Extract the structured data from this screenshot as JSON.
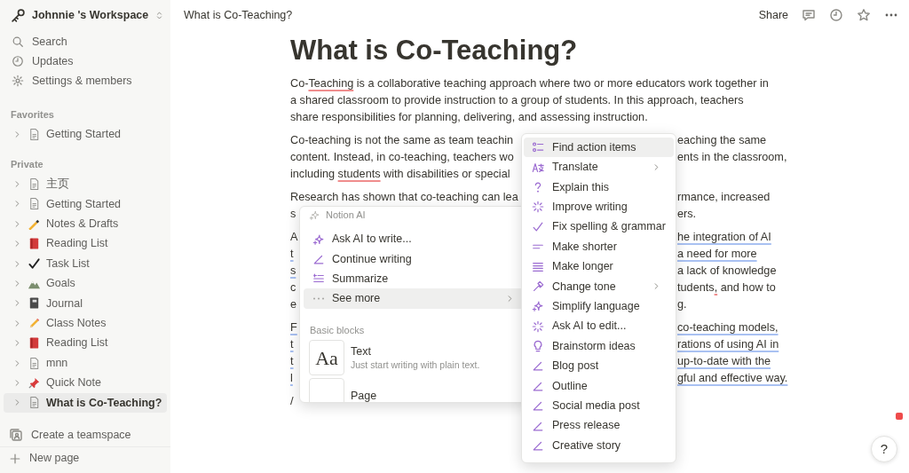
{
  "sidebar": {
    "workspace": "Johnnie 's Workspace",
    "nav": [
      "Search",
      "Updates",
      "Settings & members"
    ],
    "favorites": {
      "label": "Favorites",
      "items": [
        {
          "label": "Getting Started"
        }
      ]
    },
    "private": {
      "label": "Private",
      "items": [
        {
          "label": "主页",
          "selected": false
        },
        {
          "label": "Getting Started",
          "selected": false
        },
        {
          "label": "Notes & Drafts",
          "selected": false
        },
        {
          "label": "Reading List",
          "selected": false
        },
        {
          "label": "Task List",
          "selected": false
        },
        {
          "label": "Goals",
          "selected": false
        },
        {
          "label": "Journal",
          "selected": false
        },
        {
          "label": "Class Notes",
          "selected": false
        },
        {
          "label": "Reading List",
          "selected": false
        },
        {
          "label": "mnn",
          "selected": false
        },
        {
          "label": "Quick Note",
          "selected": false
        },
        {
          "label": "What is Co-Teaching?",
          "selected": true
        }
      ]
    },
    "create_teamspace": "Create a teamspace",
    "new_page": "New page"
  },
  "topbar": {
    "breadcrumb": "What is Co-Teaching?",
    "share": "Share"
  },
  "page": {
    "title": "What is Co-Teaching?",
    "paragraphs": [
      {
        "lines": [
          {
            "left": [
              {
                "text": "Co-"
              },
              {
                "text": "Teaching",
                "spellcheck": true
              },
              {
                "text": " is a collaborative teaching approach where two or more educators work together in"
              }
            ]
          },
          {
            "left": [
              {
                "text": "a shared classroom to provide instruction to a group of students. In this approach, teachers"
              }
            ]
          },
          {
            "left": [
              {
                "text": "share responsibilities for planning, delivering, and assessing instruction."
              }
            ]
          }
        ]
      },
      {
        "lines": [
          {
            "left": [
              {
                "text": "Co-teaching is not the same as team teachin"
              }
            ],
            "right": [
              {
                "text": "eaching the same"
              }
            ]
          },
          {
            "left": [
              {
                "text": "content. Instead, in co-teaching, teachers wo"
              }
            ],
            "right": [
              {
                "text": "ents in the classroom,"
              }
            ]
          },
          {
            "left": [
              {
                "text": "including "
              },
              {
                "text": "students",
                "spellcheck": true
              },
              {
                "text": " with disabilities or special"
              }
            ]
          }
        ]
      },
      {
        "lines": [
          {
            "left": [
              {
                "text": "Research has shown that co-teaching can lea"
              }
            ],
            "right": [
              {
                "text": "rmance, increased"
              }
            ]
          },
          {
            "left": [
              {
                "text": "s"
              }
            ],
            "right": [
              {
                "text": "ers."
              }
            ]
          }
        ]
      },
      {
        "lines": [
          {
            "left": [
              {
                "text": "A"
              }
            ],
            "right": [
              {
                "text": "he integration of AI",
                "suggested": true
              }
            ]
          },
          {
            "left": [
              {
                "text": "t",
                "suggested": true
              }
            ],
            "right": [
              {
                "text": "a need for more",
                "suggested": true
              }
            ]
          },
          {
            "left": [
              {
                "text": "s",
                "suggested": true
              }
            ],
            "right": [
              {
                "text": "a lack of knowledge"
              }
            ]
          },
          {
            "left": [
              {
                "text": "c"
              }
            ],
            "right": [
              {
                "text": "tudents"
              },
              {
                "text": ",",
                "spellcheck": true
              },
              {
                "text": " and how to"
              }
            ]
          },
          {
            "left": [
              {
                "text": "e"
              }
            ],
            "right": [
              {
                "text": "g."
              }
            ]
          }
        ]
      },
      {
        "lines": [
          {
            "left": [
              {
                "text": "F",
                "suggested": true
              }
            ],
            "right": [
              {
                "text": "co-teaching models,",
                "suggested": true
              }
            ]
          },
          {
            "left": [
              {
                "text": "t",
                "suggested": true
              }
            ],
            "right": [
              {
                "text": "rations of using AI in",
                "suggested": true
              }
            ]
          },
          {
            "left": [
              {
                "text": "t",
                "suggested": true
              }
            ],
            "right": [
              {
                "text": "up-to-date with the",
                "suggested": true
              }
            ]
          },
          {
            "left": [
              {
                "text": "l",
                "suggested": true
              }
            ],
            "right": [
              {
                "text": "gful and effective way.",
                "suggested": true
              }
            ]
          }
        ]
      }
    ],
    "command": "/"
  },
  "slash_menu": {
    "header": "Notion AI",
    "items": [
      {
        "label": "Ask AI to write...",
        "selected": false,
        "submenu": false
      },
      {
        "label": "Continue writing",
        "selected": false,
        "submenu": false
      },
      {
        "label": "Summarize",
        "selected": false,
        "submenu": false
      },
      {
        "label": "See more",
        "selected": true,
        "submenu": true
      }
    ],
    "section": "Basic blocks",
    "blocks": [
      {
        "title": "Text",
        "description": "Just start writing with plain text.",
        "thumb": "Aa"
      },
      {
        "title": "Page"
      }
    ]
  },
  "ai_menu": {
    "items": [
      {
        "label": "Find action items",
        "selected": true,
        "submenu": false
      },
      {
        "label": "Translate",
        "selected": false,
        "submenu": true
      },
      {
        "label": "Explain this",
        "selected": false,
        "submenu": false
      },
      {
        "label": "Improve writing",
        "selected": false,
        "submenu": false
      },
      {
        "label": "Fix spelling & grammar",
        "selected": false,
        "submenu": false
      },
      {
        "label": "Make shorter",
        "selected": false,
        "submenu": false
      },
      {
        "label": "Make longer",
        "selected": false,
        "submenu": false
      },
      {
        "label": "Change tone",
        "selected": false,
        "submenu": true
      },
      {
        "label": "Simplify language",
        "selected": false,
        "submenu": false
      },
      {
        "label": "Ask AI to edit...",
        "selected": false,
        "submenu": false
      },
      {
        "label": "Brainstorm ideas",
        "selected": false,
        "submenu": false
      },
      {
        "label": "Blog post",
        "selected": false,
        "submenu": false
      },
      {
        "label": "Outline",
        "selected": false,
        "submenu": false
      },
      {
        "label": "Social media post",
        "selected": false,
        "submenu": false
      },
      {
        "label": "Press release",
        "selected": false,
        "submenu": false
      },
      {
        "label": "Creative story",
        "selected": false,
        "submenu": false
      }
    ]
  },
  "help_button": "?"
}
